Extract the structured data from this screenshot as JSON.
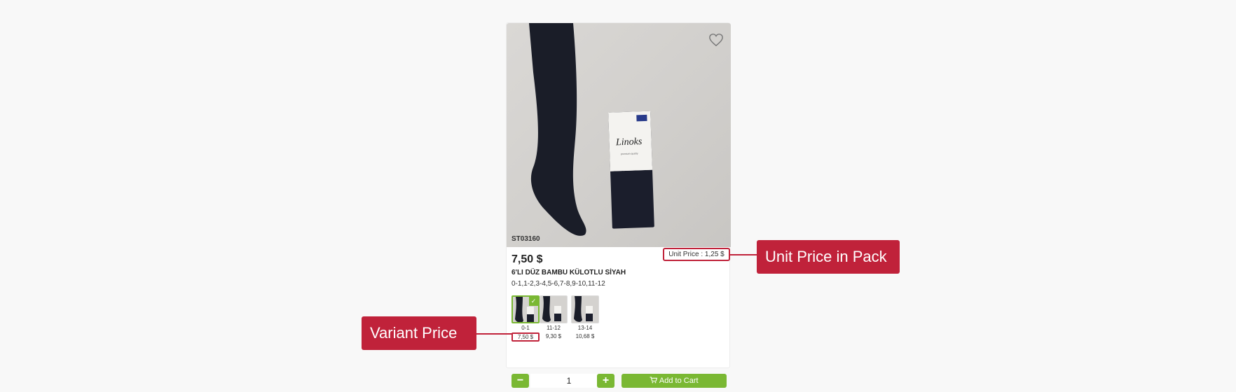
{
  "product": {
    "sku": "ST03160",
    "unit_price": "Unit Price : 1,25 $",
    "price": "7,50 $",
    "name": "6'LI DÜZ BAMBU KÜLOTLU SİYAH",
    "sizes": "0-1,1-2,3-4,5-6,7-8,9-10,11-12",
    "box_brand": "Linoks",
    "box_tagline": "premium quality"
  },
  "variants": [
    {
      "label": "0-1",
      "price": "7,50 $",
      "selected": true
    },
    {
      "label": "11-12",
      "price": "9,30 $",
      "selected": false
    },
    {
      "label": "13-14",
      "price": "10,68 $",
      "selected": false
    }
  ],
  "cart": {
    "quantity": "1",
    "minus": "−",
    "plus": "+",
    "add_label": "Add to Cart"
  },
  "annotations": {
    "unit_price": "Unit Price in Pack",
    "variant_price": "Variant Price"
  },
  "colors": {
    "accent_green": "#7ab833",
    "annotation_red": "#c0223a"
  },
  "icons": {
    "favorite": "heart-icon",
    "cart": "cart-icon",
    "selected": "check-icon"
  }
}
